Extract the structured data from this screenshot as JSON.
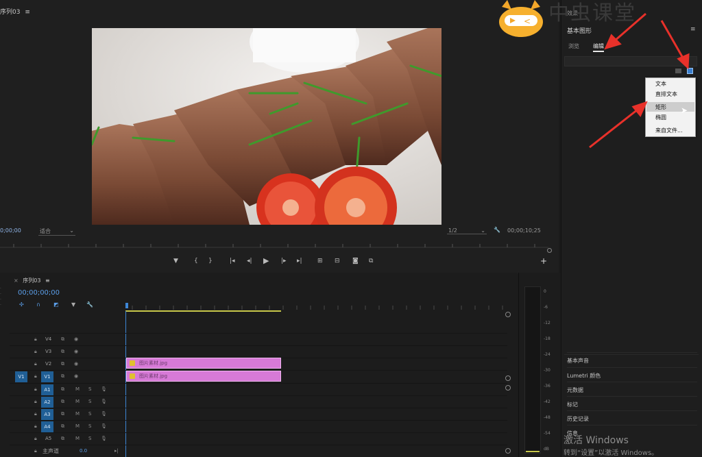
{
  "program_monitor": {
    "tab_label": "序列03",
    "timecode_left": "0;00;00",
    "fit_label": "适合",
    "resolution_label": "1/2",
    "timecode_right": "00;00;10;25"
  },
  "transport": {
    "buttons": [
      "marker-icon",
      "in-point-icon",
      "out-point-icon",
      "go-to-in-icon",
      "step-back-icon",
      "play-icon",
      "step-forward-icon",
      "go-to-out-icon",
      "lift-icon",
      "extract-icon",
      "export-frame-icon",
      "button-editor-icon"
    ],
    "add_label": "+"
  },
  "right_panel": {
    "effects_label": "效果",
    "watermark": "中虫课堂",
    "essential_graphics_title": "基本图形",
    "tab_browse": "浏览",
    "tab_edit": "编辑",
    "new_layer_menu": {
      "items": [
        "文本",
        "直排文本",
        "矩形",
        "椭圆",
        "来自文件..."
      ],
      "selected": "矩形"
    },
    "sections": [
      "基本声音",
      "Lumetri 颜色",
      "元数据",
      "标记",
      "历史记录",
      "信息"
    ]
  },
  "timeline": {
    "tab_label": "序列03",
    "timecode": "00;00;00;00",
    "video_tracks": [
      "V4",
      "V3",
      "V2",
      "V1"
    ],
    "audio_tracks": [
      "A1",
      "A2",
      "A3",
      "A4",
      "A5"
    ],
    "source_patch": "V1",
    "master_label": "主声道",
    "master_value": "0.0",
    "clips": [
      {
        "track": "V2",
        "name": "图片素材.jpg"
      },
      {
        "track": "V1",
        "name": "图片素材.jpg"
      }
    ],
    "mute_label": "M",
    "solo_label": "S"
  },
  "audio_meter": {
    "ticks": [
      "0",
      "-6",
      "-12",
      "-18",
      "-24",
      "-30",
      "-36",
      "-42",
      "-48",
      "-54",
      "dB"
    ]
  },
  "windows_activation": {
    "line1": "激活 Windows",
    "line2": "转到“设置”以激活 Windows。"
  },
  "colors": {
    "accent_blue": "#205f96",
    "clip_pink": "#d77ad7",
    "annotation_red": "#e8312a",
    "playhead_blue": "#3d86d6"
  }
}
